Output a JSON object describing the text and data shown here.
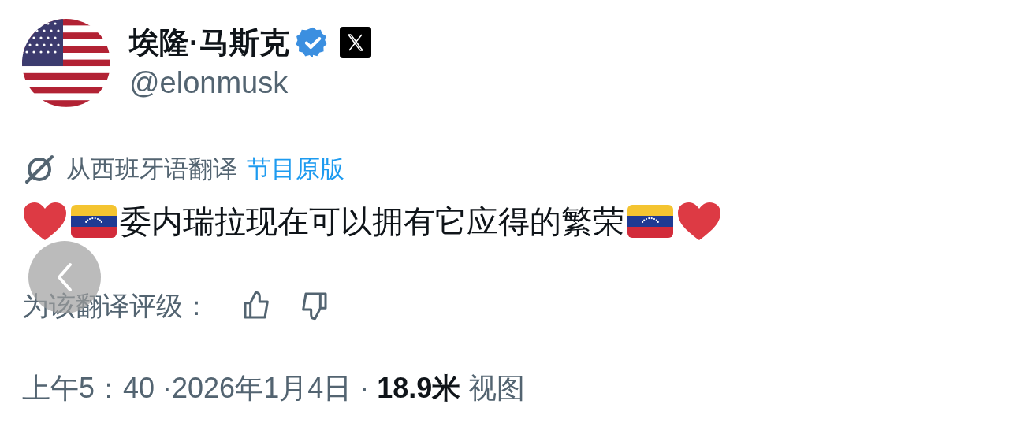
{
  "author": {
    "name": "埃隆·马斯克",
    "verified": true,
    "handle": "@elonmusk"
  },
  "translation": {
    "label": "从西班牙语翻译",
    "link": "节目原版"
  },
  "content": [
    {
      "kind": "heart"
    },
    {
      "kind": "flag"
    },
    {
      "kind": "text",
      "text": "委内瑞拉现在可以拥有它应得的繁荣"
    },
    {
      "kind": "flag"
    },
    {
      "kind": "heart"
    }
  ],
  "rating": {
    "label": "为该翻译评级："
  },
  "footer": "上午5：40 ·2026年1月4日 · **18.9米** 视图"
}
